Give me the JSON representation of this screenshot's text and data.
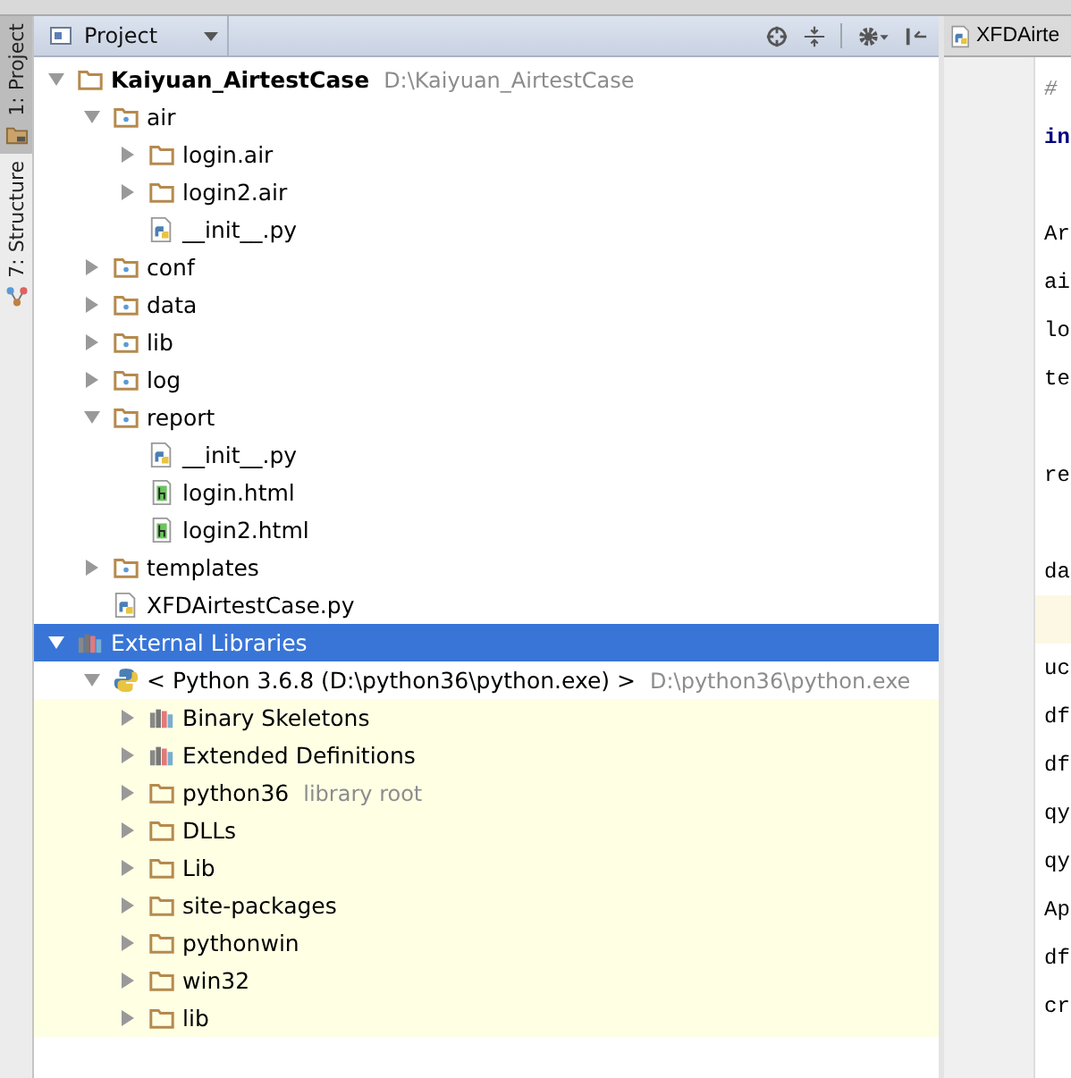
{
  "tool_stripe": [
    {
      "label": "1: Project",
      "selected": true,
      "kind": "folder"
    },
    {
      "label": "7: Structure",
      "selected": false,
      "kind": "structure"
    }
  ],
  "panel": {
    "title": "Project"
  },
  "tree": [
    {
      "label": "Kaiyuan_AirtestCase",
      "hint": "D:\\Kaiyuan_AirtestCase",
      "kind": "folder",
      "bold": true,
      "expanded": true,
      "selected": false,
      "children": [
        {
          "label": "air",
          "kind": "package",
          "expanded": true,
          "selected": false,
          "children": [
            {
              "label": "login.air",
              "kind": "folder",
              "expanded": false,
              "selected": false
            },
            {
              "label": "login2.air",
              "kind": "folder",
              "expanded": false,
              "selected": false
            },
            {
              "label": "__init__.py",
              "kind": "python-file",
              "selected": false
            }
          ]
        },
        {
          "label": "conf",
          "kind": "package",
          "expanded": false,
          "selected": false
        },
        {
          "label": "data",
          "kind": "package",
          "expanded": false,
          "selected": false
        },
        {
          "label": "lib",
          "kind": "package",
          "expanded": false,
          "selected": false
        },
        {
          "label": "log",
          "kind": "package",
          "expanded": false,
          "selected": false
        },
        {
          "label": "report",
          "kind": "package",
          "expanded": true,
          "selected": false,
          "children": [
            {
              "label": "__init__.py",
              "kind": "python-file",
              "selected": false
            },
            {
              "label": "login.html",
              "kind": "html-file",
              "selected": false
            },
            {
              "label": "login2.html",
              "kind": "html-file",
              "selected": false
            }
          ]
        },
        {
          "label": "templates",
          "kind": "package",
          "expanded": false,
          "selected": false
        },
        {
          "label": "XFDAirtestCase.py",
          "kind": "python-file",
          "selected": false
        }
      ]
    },
    {
      "label": "External Libraries",
      "kind": "library",
      "expanded": true,
      "selected": true,
      "children": [
        {
          "label": "< Python 3.6.8 (D:\\python36\\python.exe) >",
          "hint": "D:\\python36\\python.exe",
          "kind": "python-sdk",
          "expanded": true,
          "selected": false,
          "children": [
            {
              "label": "Binary Skeletons",
              "kind": "library",
              "expanded": false,
              "selected": false
            },
            {
              "label": "Extended Definitions",
              "kind": "library",
              "expanded": false,
              "selected": false
            },
            {
              "label": "python36",
              "hint": "library root",
              "kind": "folder",
              "expanded": false,
              "selected": false
            },
            {
              "label": "DLLs",
              "kind": "folder",
              "expanded": false,
              "selected": false
            },
            {
              "label": "Lib",
              "kind": "folder",
              "expanded": false,
              "selected": false
            },
            {
              "label": "site-packages",
              "kind": "folder",
              "expanded": false,
              "selected": false
            },
            {
              "label": "pythonwin",
              "kind": "folder",
              "expanded": false,
              "selected": false
            },
            {
              "label": "win32",
              "kind": "folder",
              "expanded": false,
              "selected": false
            },
            {
              "label": "lib",
              "kind": "folder",
              "expanded": false,
              "selected": false
            }
          ]
        }
      ]
    }
  ],
  "editor": {
    "tab": "XFDAirte",
    "lines": [
      {
        "text": "#",
        "kind": "comment",
        "current": false
      },
      {
        "text": "in",
        "kind": "keyword",
        "current": false
      },
      {
        "kind": "blank",
        "current": false
      },
      {
        "text": "Ar",
        "kind": "plain",
        "current": false
      },
      {
        "text": "ai",
        "kind": "plain",
        "current": false
      },
      {
        "text": "lo",
        "kind": "plain",
        "current": false
      },
      {
        "text": "te",
        "kind": "plain",
        "current": false
      },
      {
        "kind": "blank",
        "current": false
      },
      {
        "text": "re",
        "kind": "plain",
        "current": false
      },
      {
        "kind": "blank",
        "current": false
      },
      {
        "text": "da",
        "kind": "plain",
        "current": false
      },
      {
        "kind": "blank",
        "current": true
      },
      {
        "text": "uc",
        "kind": "plain",
        "current": false
      },
      {
        "text": "df",
        "kind": "plain",
        "current": false
      },
      {
        "text": "df",
        "kind": "plain",
        "current": false
      },
      {
        "text": "qy",
        "kind": "plain",
        "current": false
      },
      {
        "text": "qy",
        "kind": "plain",
        "current": false
      },
      {
        "text": "Ap",
        "kind": "plain",
        "current": false
      },
      {
        "text": "df",
        "kind": "plain",
        "current": false
      },
      {
        "text": "cr",
        "kind": "plain",
        "current": false
      }
    ]
  }
}
